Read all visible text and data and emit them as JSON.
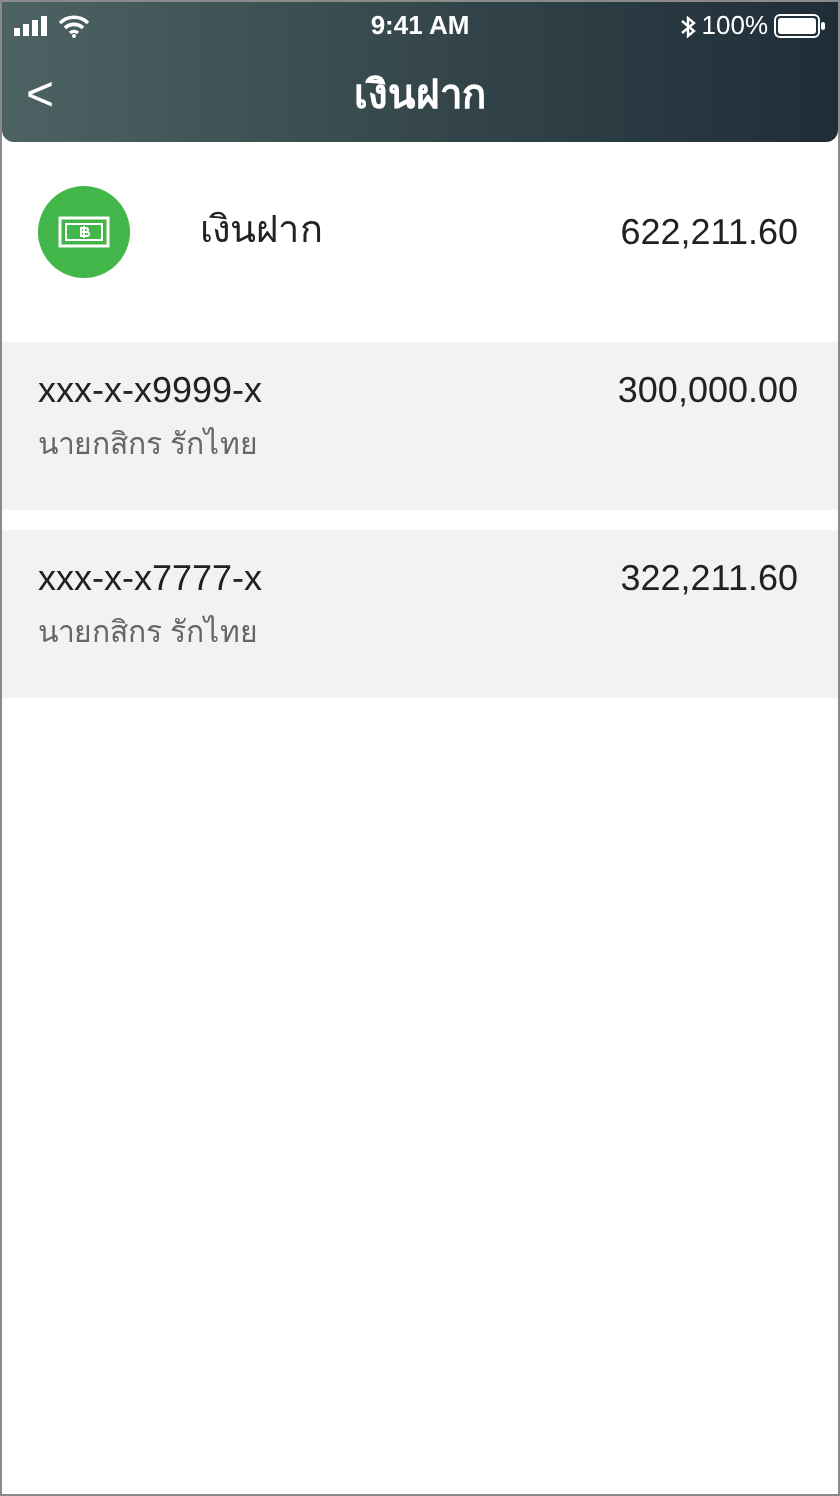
{
  "status_bar": {
    "time": "9:41 AM",
    "battery": "100%"
  },
  "nav_bar": {
    "back": "<",
    "title": "เงินฝาก"
  },
  "summary": {
    "label": "เงินฝาก",
    "amount": "622,211.60"
  },
  "accounts": [
    {
      "number": "xxx-x-x9999-x",
      "owner": "นายกสิกร รักไทย",
      "amount": "300,000.00"
    },
    {
      "number": "xxx-x-x7777-x",
      "owner": "นายกสิกร รักไทย",
      "amount": "322,211.60"
    }
  ]
}
